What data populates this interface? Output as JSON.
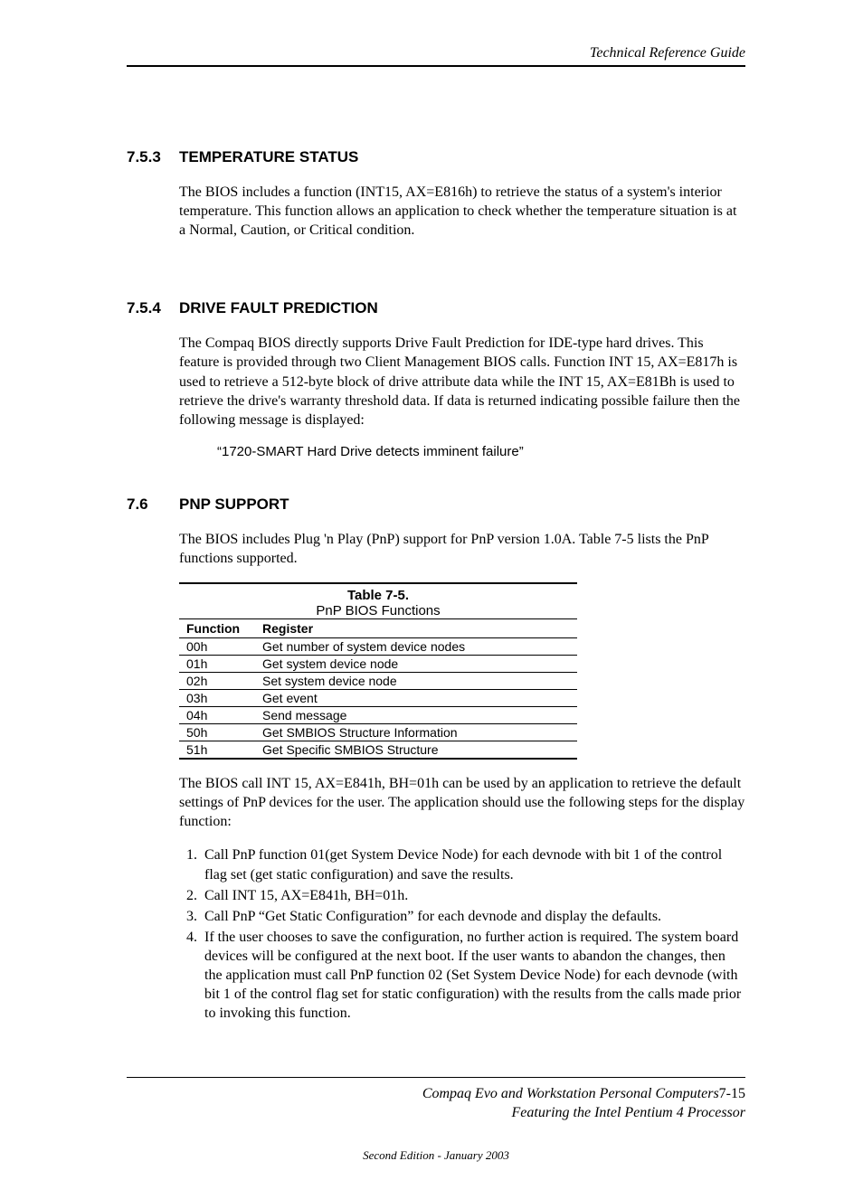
{
  "running_head": "Technical Reference Guide",
  "sections": {
    "s1": {
      "num": "7.5.3",
      "title": "TEMPERATURE STATUS",
      "p1": "The BIOS includes a function (INT15, AX=E816h) to retrieve the status of a system's interior temperature. This function allows an application to check whether the temperature situation is at a Normal, Caution, or Critical condition."
    },
    "s2": {
      "num": "7.5.4",
      "title": "DRIVE FAULT PREDICTION",
      "p1": "The Compaq BIOS directly supports Drive Fault Prediction for IDE-type hard drives. This feature is provided through two Client Management BIOS calls. Function INT 15, AX=E817h is used to retrieve a 512-byte block of drive attribute data while the INT 15, AX=E81Bh is used to retrieve the drive's warranty threshold data.  If data is returned indicating possible failure then the following message is displayed:",
      "quote": "“1720-SMART Hard Drive detects imminent failure”"
    },
    "s3": {
      "num": "7.6",
      "title": "PNP SUPPORT",
      "p1": "The BIOS includes Plug 'n Play (PnP) support for PnP version 1.0A. Table 7-5 lists the PnP functions supported.",
      "p2": "The BIOS call INT 15, AX=E841h, BH=01h can be used by an application to retrieve the default settings of PnP devices for the user. The application should use the following steps for the display function:"
    }
  },
  "table": {
    "number": "Table 7-5.",
    "title": "PnP BIOS Functions",
    "headers": {
      "c1": "Function",
      "c2": "Register"
    },
    "rows": [
      {
        "c1": "00h",
        "c2": "Get number of system device nodes"
      },
      {
        "c1": "01h",
        "c2": "Get system device node"
      },
      {
        "c1": "02h",
        "c2": "Set system device node"
      },
      {
        "c1": "03h",
        "c2": "Get event"
      },
      {
        "c1": "04h",
        "c2": "Send message"
      },
      {
        "c1": "50h",
        "c2": "Get SMBIOS Structure Information"
      },
      {
        "c1": "51h",
        "c2": "Get Specific SMBIOS Structure"
      }
    ]
  },
  "steps": [
    "Call PnP function 01(get System Device Node) for each devnode with bit 1 of the control flag set (get static configuration) and save the results.",
    "Call INT 15, AX=E841h, BH=01h.",
    "Call PnP “Get Static Configuration” for each devnode and display the defaults.",
    "If the user chooses to save the configuration, no further action is required. The system board devices will be configured at the next boot. If the user wants to abandon the changes, then the application must call PnP function 02 (Set System Device Node) for each devnode (with bit 1 of the control flag set for static configuration) with the results from the calls made prior to invoking this function."
  ],
  "footer": {
    "line1a": "Compaq Evo and Workstation Personal Computers",
    "line1b": "7-15",
    "line2": "Featuring the Intel Pentium 4 Processor",
    "edition": "Second Edition - January 2003"
  }
}
